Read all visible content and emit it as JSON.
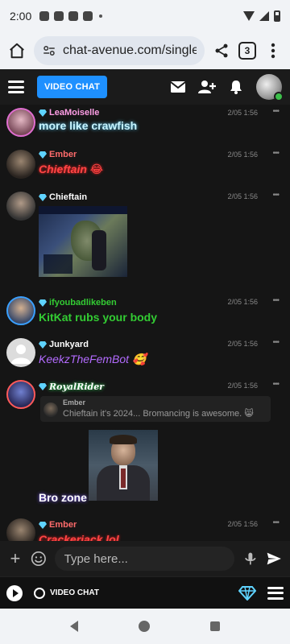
{
  "status": {
    "time": "2:00"
  },
  "browser": {
    "url": "chat-avenue.com/singles",
    "tab_count": "3"
  },
  "header": {
    "video_chat_label": "VIDEO CHAT"
  },
  "messages": [
    {
      "user": "LeaMoiselle",
      "user_color": "#ff9ee6",
      "time": "2/05 1:56",
      "text": "more like crawfish",
      "text_color": "#c7f4ff",
      "avatar_colors": [
        "#d4a0b0",
        "#5b3a4a"
      ],
      "ring": "#e06ed0"
    },
    {
      "user": "Ember",
      "user_color": "#ff5b5b",
      "time": "2/05 1:56",
      "text": "Chieftain 😂",
      "text_color": "#ff4040",
      "avatar_colors": [
        "#8a7560",
        "#2a2420"
      ]
    },
    {
      "user": "Chieftain",
      "user_color": "#ffffff",
      "time": "2/05 1:56",
      "text": "",
      "text_color": "#ffffff",
      "avatar_colors": [
        "#9a8a7a",
        "#333"
      ]
    },
    {
      "user": "ifyoubadlikeben",
      "user_color": "#33cc33",
      "time": "2/05 1:56",
      "text": "KitKat rubs your body",
      "text_color": "#33cc33",
      "avatar_colors": [
        "#c7a68a",
        "#3a4a6a"
      ],
      "ring": "#3aa0ff"
    },
    {
      "user": "Junkyard",
      "user_color": "#ffffff",
      "time": "2/05 1:56",
      "text": "KeekzTheFemBot 🥰",
      "text_color": "#b36bff",
      "avatar_colors": [
        "#dddddd",
        "#aaaaaa"
      ]
    },
    {
      "user": "RoyalRider",
      "user_color": "#ffffff",
      "time": "2/05 1:56",
      "text": "Bro zone",
      "text_color": "#ffffff",
      "avatar_colors": [
        "#6070c0",
        "#2a2a5a"
      ],
      "ring": "#ff5a5a"
    },
    {
      "user": "Ember",
      "user_color": "#ff5b5b",
      "time": "2/05 1:56",
      "text": "Crackerjack lol",
      "text_color": "#ff4040",
      "avatar_colors": [
        "#8a7560",
        "#2a2420"
      ]
    }
  ],
  "quote": {
    "user": "Ember",
    "text": "Chieftain it's 2024... Bromancing is awesome. 😸"
  },
  "input": {
    "placeholder": "Type here..."
  },
  "bottom": {
    "video_chat_label": "VIDEO CHAT"
  },
  "colors": {
    "accent": "#1e90ff",
    "gem": "#5fd3ff",
    "online": "#3cbf4a"
  }
}
